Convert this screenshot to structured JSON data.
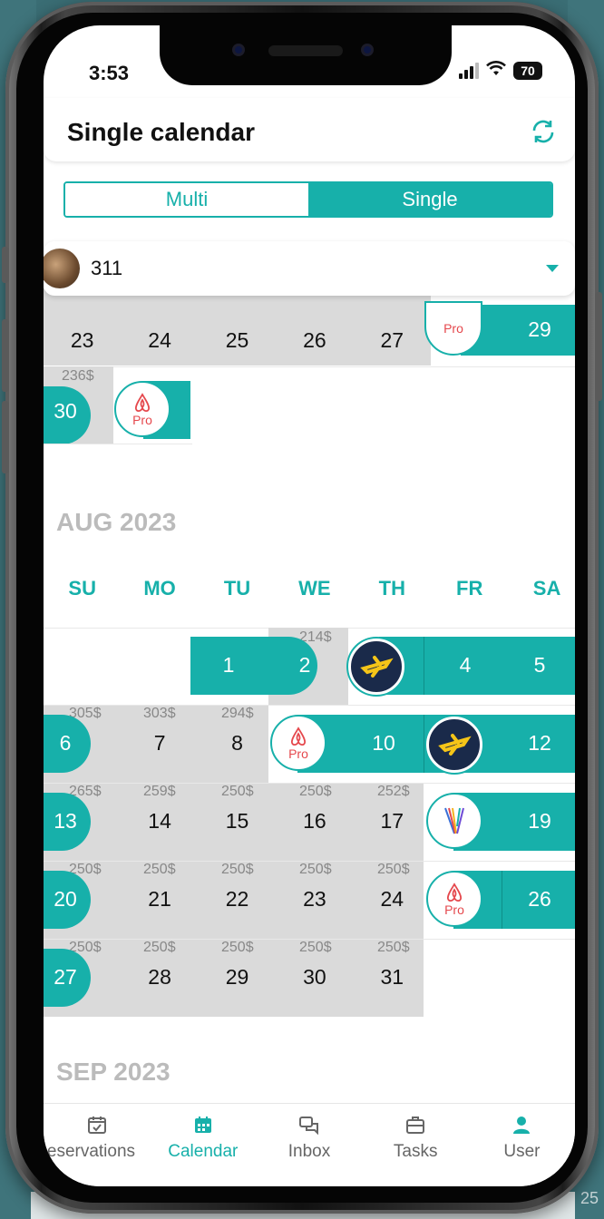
{
  "status": {
    "time": "3:53",
    "battery": "70"
  },
  "header": {
    "title": "Single calendar"
  },
  "segment": {
    "multi": "Multi",
    "single": "Single"
  },
  "property": {
    "name": "311"
  },
  "july_tail": {
    "row1": [
      "23",
      "24",
      "25",
      "26",
      "27",
      "29"
    ],
    "row2_price": "236$",
    "row2_day": "30"
  },
  "august": {
    "title": "AUG 2023",
    "weekdays": [
      "SU",
      "MO",
      "TU",
      "WE",
      "TH",
      "FR",
      "SA"
    ],
    "row1": {
      "wed_price": "214$",
      "days": [
        "1",
        "2",
        "4",
        "5"
      ]
    },
    "row2": {
      "prices": [
        "305$",
        "303$",
        "294$"
      ],
      "days": [
        "6",
        "7",
        "8",
        "10",
        "12"
      ]
    },
    "row3": {
      "prices": [
        "265$",
        "259$",
        "250$",
        "250$",
        "252$"
      ],
      "days": [
        "13",
        "14",
        "15",
        "16",
        "17",
        "19"
      ]
    },
    "row4": {
      "prices": [
        "250$",
        "250$",
        "250$",
        "250$",
        "250$"
      ],
      "days": [
        "20",
        "21",
        "22",
        "23",
        "24",
        "26"
      ]
    },
    "row5": {
      "prices": [
        "250$",
        "250$",
        "250$",
        "250$",
        "250$"
      ],
      "days": [
        "27",
        "28",
        "29",
        "30",
        "31"
      ]
    }
  },
  "september": {
    "title": "SEP 2023"
  },
  "channels": {
    "pro_label": "Pro"
  },
  "tabs": [
    {
      "label": "Reservations",
      "icon": "calendar-check-icon"
    },
    {
      "label": "Calendar",
      "icon": "calendar-grid-icon"
    },
    {
      "label": "Inbox",
      "icon": "chat-bubbles-icon"
    },
    {
      "label": "Tasks",
      "icon": "briefcase-icon"
    },
    {
      "label": "User",
      "icon": "user-icon"
    }
  ],
  "background_text": "25",
  "colors": {
    "accent": "#17b0aa",
    "gray_cell": "#dadada",
    "airbnb": "#e5484d",
    "expedia": "#1a2a4a"
  }
}
